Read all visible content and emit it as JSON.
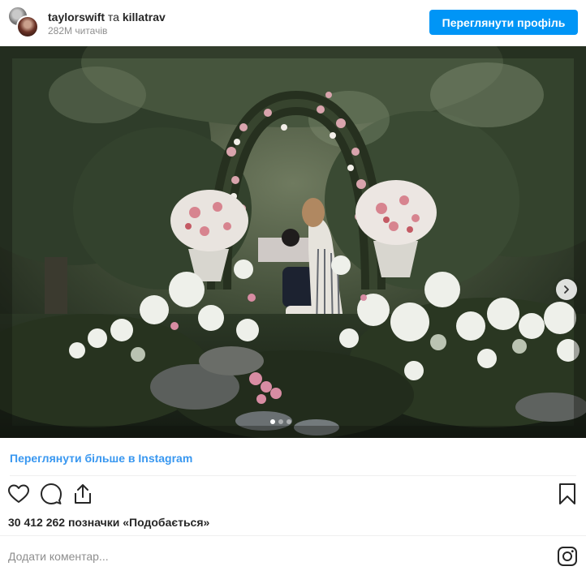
{
  "header": {
    "user1": "taylorswift",
    "separator": "та",
    "user2": "killatrav",
    "followers": "282M читачів",
    "view_profile_label": "Переглянути профіль"
  },
  "media": {
    "image_icon": "engagement-garden-photo",
    "next_icon": "chevron-right-icon",
    "carousel_count": 3,
    "carousel_active": 1
  },
  "view_more_label": "Переглянути більше в Instagram",
  "actions": {
    "like_icon": "heart-icon",
    "comment_icon": "comment-icon",
    "share_icon": "share-icon",
    "save_icon": "bookmark-icon"
  },
  "likes_text": "30 412 262 позначки «Подобається»",
  "comment": {
    "placeholder": "Додати коментар...",
    "instagram_icon": "instagram-icon"
  },
  "colors": {
    "accent": "#0095f6",
    "link": "#3897f0",
    "text": "#262626",
    "muted": "#8e8e8e"
  }
}
